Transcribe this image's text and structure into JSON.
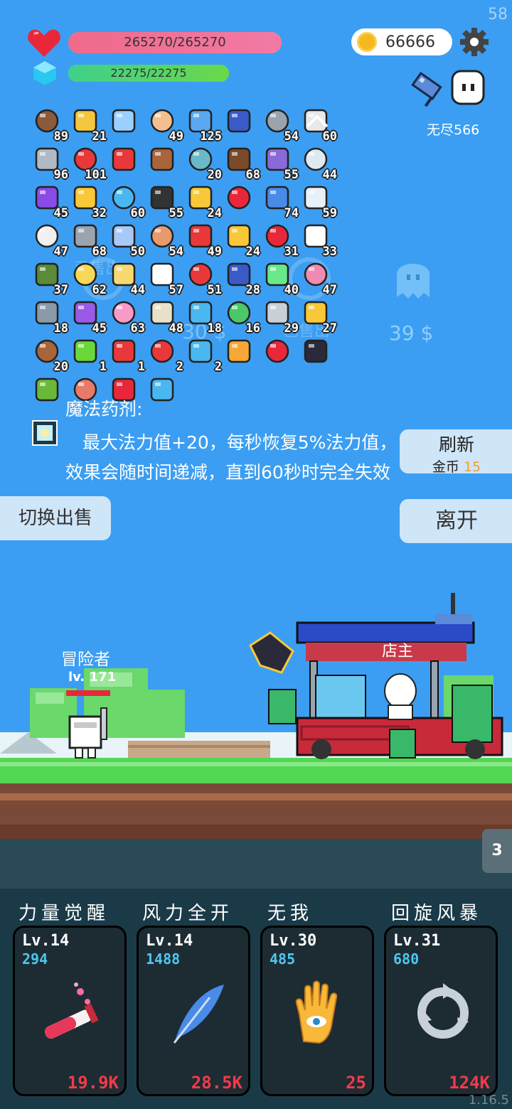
{
  "fps": "58",
  "version": "1.16.5",
  "status": {
    "hp": "265270/265270",
    "hp_fraction": 1.0,
    "mp": "22275/22275",
    "mp_fraction": 1.0
  },
  "coins": "66666",
  "mode_label": "无尽566",
  "items": [
    {
      "icon": "compass",
      "count": "89",
      "color": "#8a5a3a"
    },
    {
      "icon": "lightbulb",
      "count": "21",
      "color": "#f3c840"
    },
    {
      "icon": "magnifier",
      "count": "",
      "color": "#9ad0ff"
    },
    {
      "icon": "punch",
      "count": "49",
      "color": "#f2c090"
    },
    {
      "icon": "picture-card",
      "count": "125",
      "color": "#5aa8f2"
    },
    {
      "icon": "tarot-cards",
      "count": "",
      "color": "#3a5ac8"
    },
    {
      "icon": "spiked-ball",
      "count": "54",
      "color": "#9aa4ae"
    },
    {
      "icon": "playing-cards",
      "count": "60",
      "color": "#e8e8e8"
    },
    {
      "icon": "sword",
      "count": "96",
      "color": "#b0bac4"
    },
    {
      "icon": "red-boot",
      "count": "101",
      "color": "#e8383a"
    },
    {
      "icon": "magnet",
      "count": "",
      "color": "#e8383a"
    },
    {
      "icon": "treasure-chest",
      "count": "",
      "color": "#a8643a"
    },
    {
      "icon": "disc",
      "count": "20",
      "color": "#6ab8c8"
    },
    {
      "icon": "coconut",
      "count": "68",
      "color": "#7a4a2a"
    },
    {
      "icon": "star-shield",
      "count": "55",
      "color": "#8a6ad8"
    },
    {
      "icon": "envelope",
      "count": "44",
      "color": "#e0e8f0"
    },
    {
      "icon": "purple-box",
      "count": "45",
      "color": "#8a4ae8"
    },
    {
      "icon": "sunflower",
      "count": "32",
      "color": "#f8c838"
    },
    {
      "icon": "blue-bomb",
      "count": "60",
      "color": "#4ab8f0"
    },
    {
      "icon": "black-bomb",
      "count": "55",
      "color": "#333333"
    },
    {
      "icon": "crown",
      "count": "24",
      "color": "#f8c838"
    },
    {
      "icon": "ruby",
      "count": "",
      "color": "#e8283a"
    },
    {
      "icon": "shield",
      "count": "74",
      "color": "#4a8ae8"
    },
    {
      "icon": "cloud",
      "count": "59",
      "color": "#e8f0f8"
    },
    {
      "icon": "dice",
      "count": "47",
      "color": "#f0f0f0"
    },
    {
      "icon": "elephant",
      "count": "68",
      "color": "#9aa4ae"
    },
    {
      "icon": "capsule",
      "count": "50",
      "color": "#a8c8f8"
    },
    {
      "icon": "potion-flask",
      "count": "54",
      "color": "#e89a6a"
    },
    {
      "icon": "red-pill",
      "count": "49",
      "color": "#e8383a"
    },
    {
      "icon": "magic-wand",
      "count": "24",
      "color": "#f8c838"
    },
    {
      "icon": "heart-arrow",
      "count": "31",
      "color": "#e8283a"
    },
    {
      "icon": "ghost-pet",
      "count": "33",
      "color": "#ffffff"
    },
    {
      "icon": "grenade",
      "count": "37",
      "color": "#5a8a3a"
    },
    {
      "icon": "halo",
      "count": "62",
      "color": "#f8d858"
    },
    {
      "icon": "paper-scroll",
      "count": "44",
      "color": "#f8d870"
    },
    {
      "icon": "fried-egg",
      "count": "57",
      "color": "#ffffff"
    },
    {
      "icon": "gift-box",
      "count": "51",
      "color": "#e8383a"
    },
    {
      "icon": "blue-book",
      "count": "28",
      "color": "#3a5ac8"
    },
    {
      "icon": "green-slime",
      "count": "40",
      "color": "#6ae88a"
    },
    {
      "icon": "perfume",
      "count": "47",
      "color": "#f08ab0"
    },
    {
      "icon": "stopwatch",
      "count": "18",
      "color": "#8a9aa8"
    },
    {
      "icon": "crystal-ball",
      "count": "45",
      "color": "#9a5ae8"
    },
    {
      "icon": "ice-cream",
      "count": "63",
      "color": "#f89ac8"
    },
    {
      "icon": "idea-bulb",
      "count": "48",
      "color": "#e8e0c8"
    },
    {
      "icon": "crosshair",
      "count": "18",
      "color": "#4ab8f0"
    },
    {
      "icon": "cash-heart",
      "count": "16",
      "color": "#4ac86a"
    },
    {
      "icon": "hook",
      "count": "29",
      "color": "#c8d0d8"
    },
    {
      "icon": "diamond-ring",
      "count": "27",
      "color": "#f8c838"
    },
    {
      "icon": "bow-arrow",
      "count": "20",
      "color": "#a8643a"
    },
    {
      "icon": "lime",
      "count": "1",
      "color": "#6ad83a"
    },
    {
      "icon": "thermometer",
      "count": "1",
      "color": "#e8383a"
    },
    {
      "icon": "red-shield",
      "count": "2",
      "color": "#e8383a"
    },
    {
      "icon": "blue-scroll",
      "count": "2",
      "color": "#4ab8f0"
    },
    {
      "icon": "orange-scroll",
      "count": "",
      "color": "#f8a838"
    },
    {
      "icon": "heart",
      "count": "",
      "color": "#e8283a"
    },
    {
      "icon": "bat",
      "count": "",
      "color": "#2a2a3a"
    },
    {
      "icon": "green-monster",
      "count": "",
      "color": "#6ab83a"
    },
    {
      "icon": "meat",
      "count": "",
      "color": "#e87a6a"
    },
    {
      "icon": "bookmark",
      "count": "",
      "color": "#e8283a"
    },
    {
      "icon": "speech-bubble",
      "count": "",
      "color": "#4ab8f0"
    }
  ],
  "shop": {
    "sold_left": "已售出",
    "sold_right": "已售出",
    "price_mid": "30 $",
    "price_ghost": "39 $",
    "desc_title": "魔法药剂:",
    "desc_text": "最大法力值+20，每秒恢复5%法力值，效果会随时间递减，直到60秒时完全失效",
    "refresh_label": "刷新",
    "refresh_cost_label": "金币",
    "refresh_cost": "15",
    "leave_label": "离开",
    "switch_label": "切换出售",
    "shopkeeper_label": "店主"
  },
  "hero": {
    "name": "冒险者",
    "level": "lv. 171"
  },
  "page_tab": "3",
  "skills": [
    {
      "name": "力量觉醒",
      "lv": "Lv.14",
      "cost": "294",
      "price": "19.9K",
      "icon": "potion-tube-icon"
    },
    {
      "name": "风力全开",
      "lv": "Lv.14",
      "cost": "1488",
      "price": "28.5K",
      "icon": "feather-icon"
    },
    {
      "name": "无我",
      "lv": "Lv.30",
      "cost": "485",
      "price": "25",
      "icon": "eye-hand-icon"
    },
    {
      "name": "回旋风暴",
      "lv": "Lv.31",
      "cost": "680",
      "price": "124K",
      "icon": "cycle-arrows-icon"
    }
  ],
  "colors": {
    "background": "#3b9ef2",
    "hp": "#f06a8a",
    "mp": "#3fd08a",
    "cost": "#4dc8f0",
    "price": "#f23a4a"
  }
}
